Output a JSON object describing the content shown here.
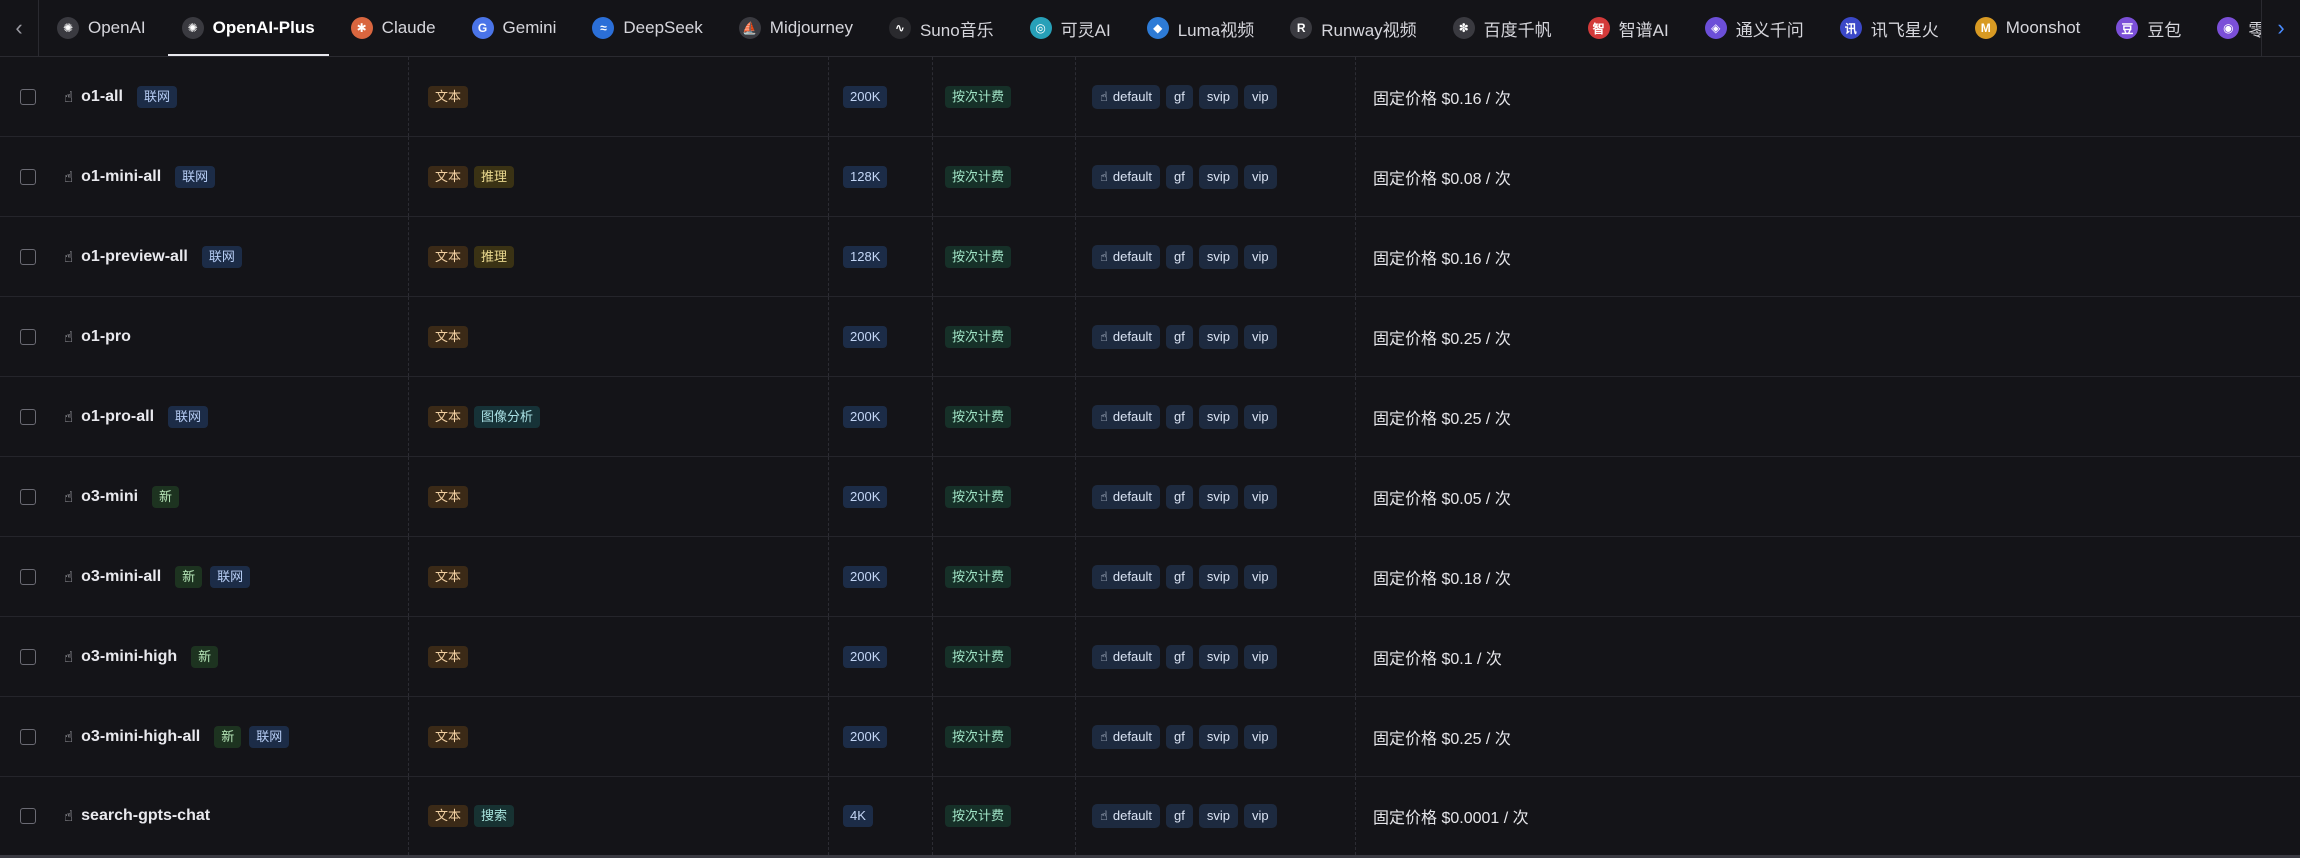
{
  "nav": {
    "scroll_left": "‹",
    "scroll_right": "›",
    "tabs": [
      {
        "label": "OpenAI",
        "icon": "openai-icon",
        "glyph": "✺",
        "color": "#3a3a40"
      },
      {
        "label": "OpenAI-Plus",
        "icon": "openai-icon",
        "glyph": "✺",
        "color": "#3a3a40",
        "active": true
      },
      {
        "label": "Claude",
        "icon": "claude-icon",
        "glyph": "✱",
        "color": "#d9663f"
      },
      {
        "label": "Gemini",
        "icon": "google-icon",
        "glyph": "G",
        "color": "#4a74e8"
      },
      {
        "label": "DeepSeek",
        "icon": "deepseek-icon",
        "glyph": "≈",
        "color": "#2b6fd8"
      },
      {
        "label": "Midjourney",
        "icon": "midjourney-icon",
        "glyph": "⛵",
        "color": "#3a3a40"
      },
      {
        "label": "Suno音乐",
        "icon": "suno-icon",
        "glyph": "∿",
        "color": "#2a2a2e"
      },
      {
        "label": "可灵AI",
        "icon": "kling-icon",
        "glyph": "◎",
        "color": "#27a0b8"
      },
      {
        "label": "Luma视频",
        "icon": "luma-icon",
        "glyph": "◆",
        "color": "#2d7bd6"
      },
      {
        "label": "Runway视频",
        "icon": "runway-icon",
        "glyph": "R",
        "color": "#3a3a40"
      },
      {
        "label": "百度千帆",
        "icon": "baidu-icon",
        "glyph": "✽",
        "color": "#3a3a40"
      },
      {
        "label": "智谱AI",
        "icon": "zhipu-icon",
        "glyph": "智",
        "color": "#d33a3a"
      },
      {
        "label": "通义千问",
        "icon": "tongyi-icon",
        "glyph": "◈",
        "color": "#6c4fd8"
      },
      {
        "label": "讯飞星火",
        "icon": "xunfei-icon",
        "glyph": "讯",
        "color": "#3b48c8"
      },
      {
        "label": "Moonshot",
        "icon": "moonshot-icon",
        "glyph": "M",
        "color": "#d89a23"
      },
      {
        "label": "豆包",
        "icon": "doubao-icon",
        "glyph": "豆",
        "color": "#7b4fd8"
      },
      {
        "label": "零",
        "icon": "partial-tab-icon",
        "glyph": "◉",
        "color": "#7b4fd8"
      }
    ]
  },
  "table": {
    "rows": [
      {
        "name": "o1-all",
        "flags": [
          "联网"
        ],
        "caps": [
          "文本"
        ],
        "ctx": "200K",
        "billing": "按次计费",
        "groups": [
          "default",
          "gf",
          "svip",
          "vip"
        ],
        "price": "固定价格 $0.16 / 次"
      },
      {
        "name": "o1-mini-all",
        "flags": [
          "联网"
        ],
        "caps": [
          "文本",
          "推理"
        ],
        "ctx": "128K",
        "billing": "按次计费",
        "groups": [
          "default",
          "gf",
          "svip",
          "vip"
        ],
        "price": "固定价格 $0.08 / 次"
      },
      {
        "name": "o1-preview-all",
        "flags": [
          "联网"
        ],
        "caps": [
          "文本",
          "推理"
        ],
        "ctx": "128K",
        "billing": "按次计费",
        "groups": [
          "default",
          "gf",
          "svip",
          "vip"
        ],
        "price": "固定价格 $0.16 / 次"
      },
      {
        "name": "o1-pro",
        "flags": [],
        "caps": [
          "文本"
        ],
        "ctx": "200K",
        "billing": "按次计费",
        "groups": [
          "default",
          "gf",
          "svip",
          "vip"
        ],
        "price": "固定价格 $0.25 / 次"
      },
      {
        "name": "o1-pro-all",
        "flags": [
          "联网"
        ],
        "caps": [
          "文本",
          "图像分析"
        ],
        "ctx": "200K",
        "billing": "按次计费",
        "groups": [
          "default",
          "gf",
          "svip",
          "vip"
        ],
        "price": "固定价格 $0.25 / 次"
      },
      {
        "name": "o3-mini",
        "flags": [
          "新"
        ],
        "caps": [
          "文本"
        ],
        "ctx": "200K",
        "billing": "按次计费",
        "groups": [
          "default",
          "gf",
          "svip",
          "vip"
        ],
        "price": "固定价格 $0.05 / 次"
      },
      {
        "name": "o3-mini-all",
        "flags": [
          "新",
          "联网"
        ],
        "caps": [
          "文本"
        ],
        "ctx": "200K",
        "billing": "按次计费",
        "groups": [
          "default",
          "gf",
          "svip",
          "vip"
        ],
        "price": "固定价格 $0.18 / 次"
      },
      {
        "name": "o3-mini-high",
        "flags": [
          "新"
        ],
        "caps": [
          "文本"
        ],
        "ctx": "200K",
        "billing": "按次计费",
        "groups": [
          "default",
          "gf",
          "svip",
          "vip"
        ],
        "price": "固定价格 $0.1 / 次"
      },
      {
        "name": "o3-mini-high-all",
        "flags": [
          "新",
          "联网"
        ],
        "caps": [
          "文本"
        ],
        "ctx": "200K",
        "billing": "按次计费",
        "groups": [
          "default",
          "gf",
          "svip",
          "vip"
        ],
        "price": "固定价格 $0.25 / 次"
      },
      {
        "name": "search-gpts-chat",
        "flags": [],
        "caps": [
          "文本",
          "搜索"
        ],
        "ctx": "4K",
        "billing": "按次计费",
        "groups": [
          "default",
          "gf",
          "svip",
          "vip"
        ],
        "price": "固定价格 $0.0001 / 次"
      }
    ]
  },
  "colors": {
    "background": "#141418",
    "tag_net": "#1c2c47",
    "tag_new": "#1d3320",
    "tag_text": "#3b2a17",
    "tag_reason": "#3a3214",
    "tag_billing": "#163028"
  }
}
